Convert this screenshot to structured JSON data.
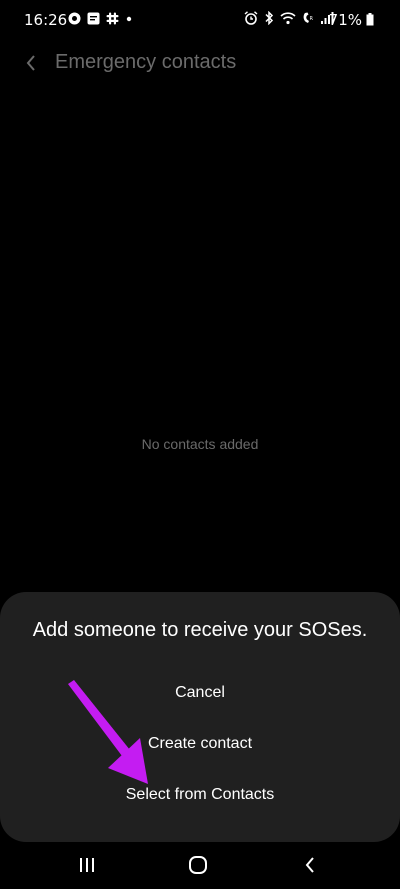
{
  "status_bar": {
    "time": "16:26",
    "battery": "71%",
    "left_icons": [
      "record-icon",
      "message-icon",
      "slack-icon",
      "dot-icon"
    ],
    "right_icons": [
      "alarm-icon",
      "bluetooth-icon",
      "wifi-icon",
      "volte-icon",
      "signal-icon"
    ]
  },
  "app_bar": {
    "back_icon": "chevron-left-icon",
    "title": "Emergency contacts"
  },
  "main": {
    "empty_text": "No contacts added"
  },
  "sheet": {
    "title": "Add someone to receive your SOSes.",
    "options": [
      {
        "label": "Cancel"
      },
      {
        "label": "Create contact"
      },
      {
        "label": "Select from Contacts"
      }
    ]
  },
  "annotation": {
    "color": "#c41cf2",
    "icon": "arrow-annotation"
  },
  "nav_bar": {
    "recents_icon": "recents-icon",
    "home_icon": "home-icon",
    "back_icon": "back-icon"
  }
}
